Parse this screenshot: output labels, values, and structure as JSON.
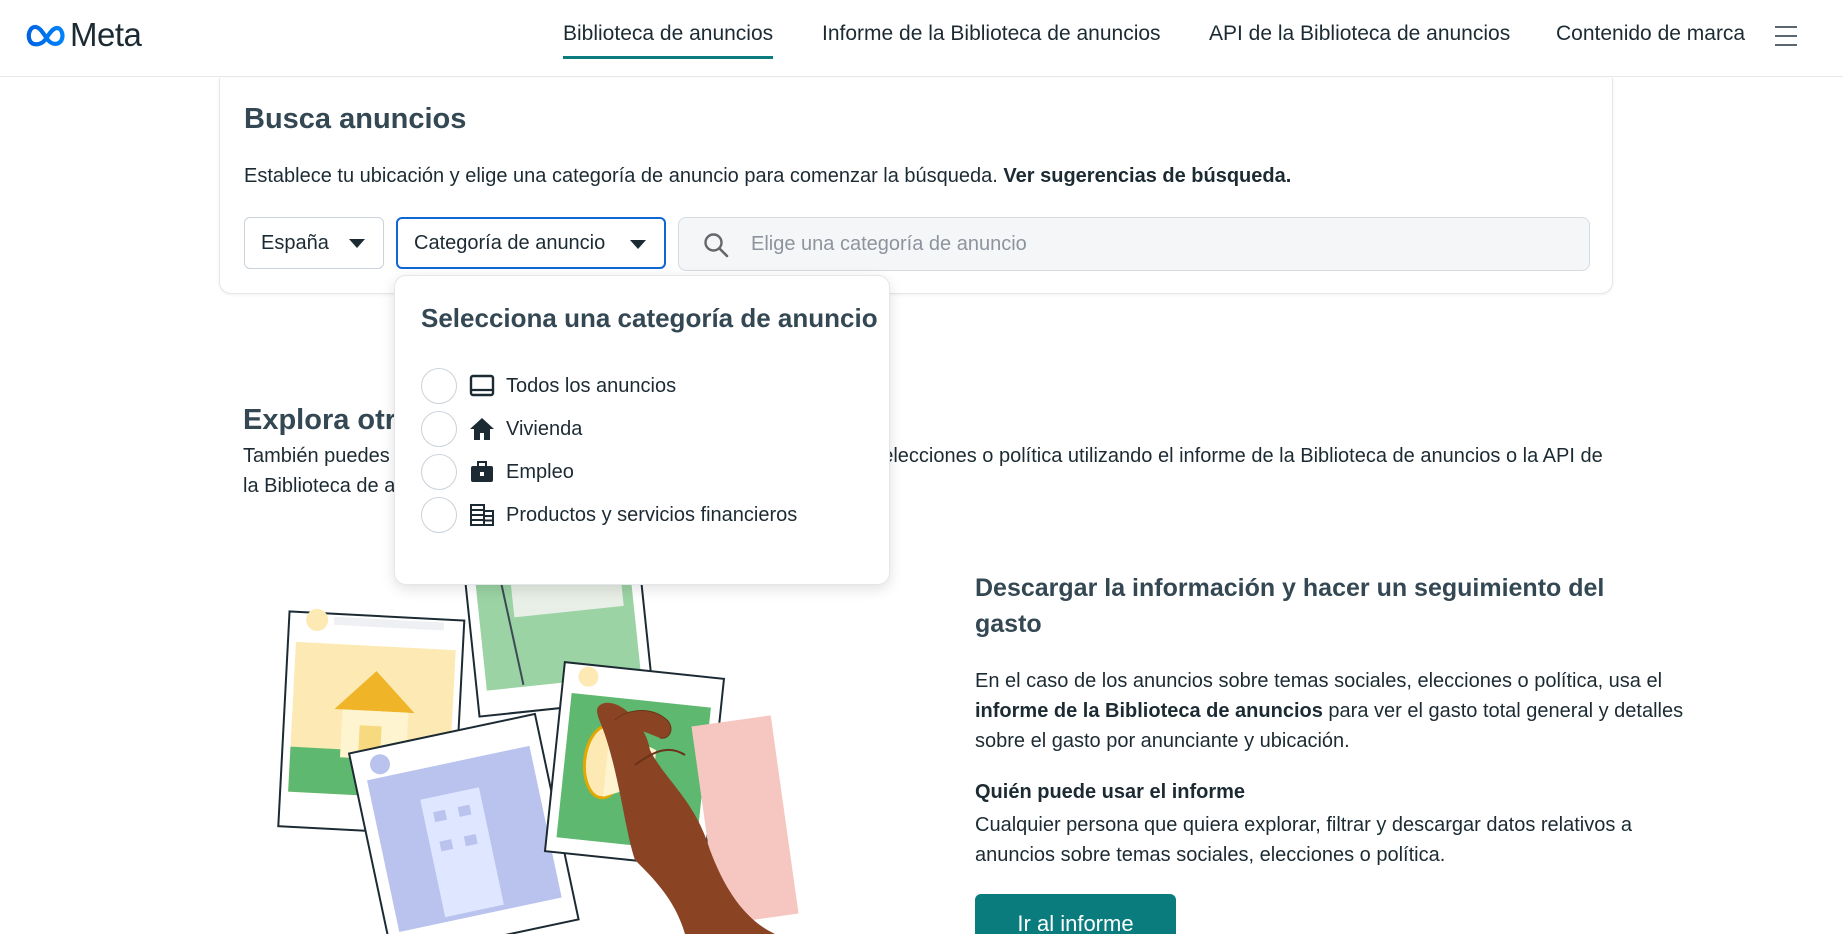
{
  "header": {
    "logo_text": "Meta",
    "nav": [
      {
        "label": "Biblioteca de anuncios",
        "active": true
      },
      {
        "label": "Informe de la Biblioteca de anuncios",
        "active": false
      },
      {
        "label": "API de la Biblioteca de anuncios",
        "active": false
      },
      {
        "label": "Contenido de marca",
        "active": false
      }
    ]
  },
  "search_card": {
    "title": "Busca anuncios",
    "description": "Establece tu ubicación y elige una categoría de anuncio para comenzar la búsqueda.",
    "description_link": "Ver sugerencias de búsqueda.",
    "country_select": "España",
    "category_select": "Categoría de anuncio",
    "search_placeholder": "Elige una categoría de anuncio"
  },
  "dropdown": {
    "title": "Selecciona una categoría de anuncio",
    "options": [
      {
        "label": "Todos los anuncios",
        "icon": "tablet-icon"
      },
      {
        "label": "Vivienda",
        "icon": "house-icon"
      },
      {
        "label": "Empleo",
        "icon": "briefcase-icon"
      },
      {
        "label": "Productos y servicios financieros",
        "icon": "money-stack-icon"
      }
    ]
  },
  "explore": {
    "title": "Explora otras opciones",
    "description": "También puedes buscar información sobre anuncios de temas sociales, elecciones o política utilizando el informe de la Biblioteca de anuncios o la API de la Biblioteca de anuncios."
  },
  "info": {
    "title": "Descargar la información y hacer un seguimiento del gasto",
    "p_before": "En el caso de los anuncios sobre temas sociales, elecciones o política, usa el ",
    "p_bold": "informe de la Biblioteca de anuncios",
    "p_after": " para ver el gasto total general y detalles sobre el gasto por anunciante y ubicación.",
    "who_title": "Quién puede usar el informe",
    "who_desc": "Cualquier persona que quiera explorar, filtrar y descargar datos relativos a anuncios sobre temas sociales, elecciones o política.",
    "cta_label": "Ir al informe"
  },
  "colors": {
    "accent": "#0a7c7d",
    "focus_border": "#0f66d5",
    "text": "#1c2b33"
  }
}
